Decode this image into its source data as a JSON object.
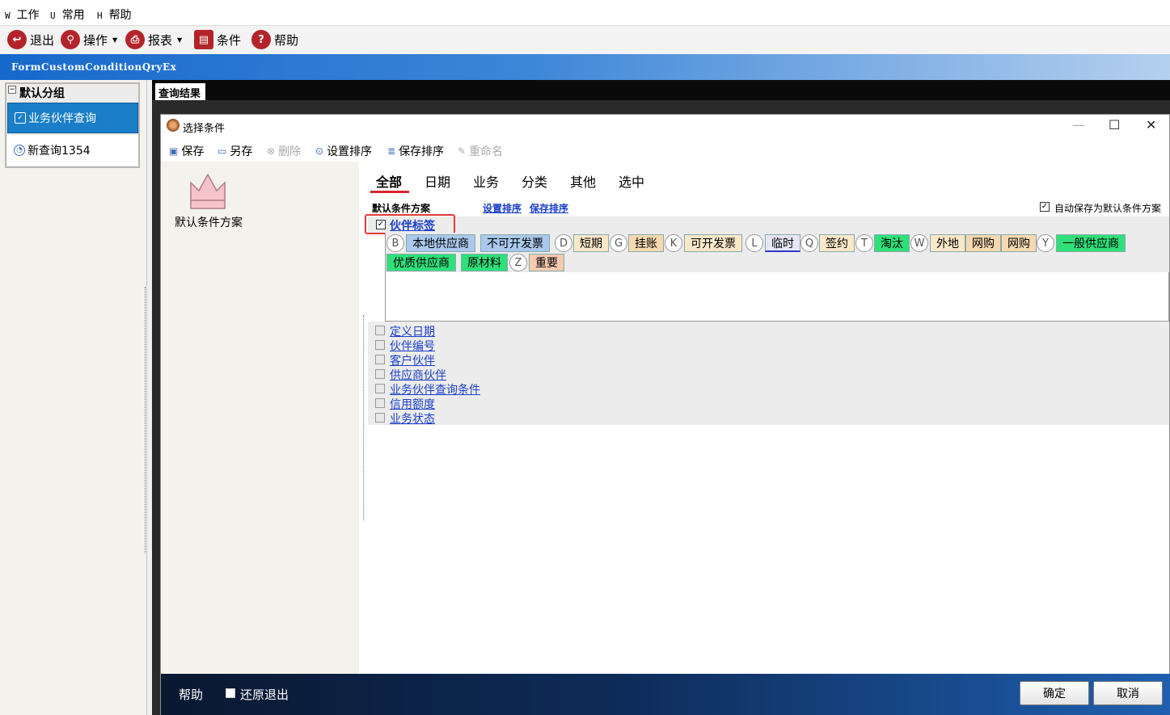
{
  "menu": [
    {
      "accel": "W",
      "label": "工作"
    },
    {
      "accel": "U",
      "label": "常用"
    },
    {
      "accel": "H",
      "label": "帮助"
    }
  ],
  "toolbar": {
    "exit": "退出",
    "operate": "操作",
    "report": "报表",
    "condition": "条件",
    "help": "帮助"
  },
  "form_title": "FormCustomConditionQryEx",
  "group": {
    "title": "默认分组",
    "items": [
      "业务伙伴查询",
      "新查询1354"
    ]
  },
  "results_tab": "查询结果",
  "dialog": {
    "title": "选择条件",
    "toolbar": {
      "save": "保存",
      "save_as": "另存",
      "delete": "删除",
      "set_sort": "设置排序",
      "save_sort": "保存排序",
      "rename": "重命名"
    },
    "scheme_label": "默认条件方案",
    "tabs": [
      "全部",
      "日期",
      "业务",
      "分类",
      "其他",
      "选中"
    ],
    "scheme_name": "默认条件方案",
    "link_set_sort": "设置排序",
    "link_save_sort": "保存排序",
    "autosave_label": "自动保存为默认条件方案",
    "tag_label": "伙伴标签",
    "letters": [
      "B",
      "D",
      "G",
      "K",
      "L",
      "Q",
      "T",
      "W",
      "Y",
      "Z"
    ],
    "chips_row1": [
      "本地供应商",
      "不可开发票",
      "短期",
      "挂账",
      "可开发票",
      "临时",
      "签约",
      "淘汰",
      "外地",
      "网购",
      "网购",
      "一般供应商"
    ],
    "chips_row2": [
      "优质供应商",
      "原材料",
      "重要"
    ],
    "conditions": [
      "定义日期",
      "伙伴编号",
      "客户伙伴",
      "供应商伙伴",
      "业务伙伴查询条件",
      "信用额度",
      "业务状态"
    ],
    "footer_help": "帮助",
    "restore_label": "还原退出",
    "ok": "确定",
    "cancel": "取消"
  }
}
